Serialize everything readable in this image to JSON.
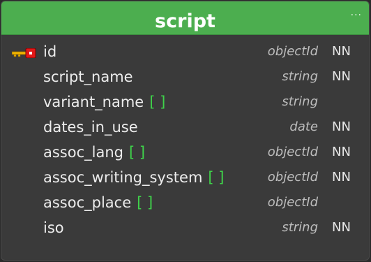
{
  "table": {
    "title": "script",
    "menu_label": "···",
    "colors": {
      "header": "#4cae4f",
      "body": "#3a3a3a",
      "array_badge": "#3fd24a",
      "key_icon_gold": "#f2b400",
      "key_icon_red": "#e11818"
    },
    "columns": [
      {
        "name": "id",
        "type": "objectId",
        "nn": "NN",
        "array_badge": "",
        "icon": "primary-key-icon"
      },
      {
        "name": "script_name",
        "type": "string",
        "nn": "NN",
        "array_badge": "",
        "icon": ""
      },
      {
        "name": "variant_name",
        "type": "string",
        "nn": "",
        "array_badge": "[ ]",
        "icon": ""
      },
      {
        "name": "dates_in_use",
        "type": "date",
        "nn": "NN",
        "array_badge": "",
        "icon": ""
      },
      {
        "name": "assoc_lang",
        "type": "objectId",
        "nn": "NN",
        "array_badge": "[ ]",
        "icon": ""
      },
      {
        "name": "assoc_writing_system",
        "type": "objectId",
        "nn": "NN",
        "array_badge": "[ ]",
        "icon": ""
      },
      {
        "name": "assoc_place",
        "type": "objectId",
        "nn": "",
        "array_badge": "[ ]",
        "icon": ""
      },
      {
        "name": "iso",
        "type": "string",
        "nn": "NN",
        "array_badge": "",
        "icon": ""
      }
    ]
  }
}
